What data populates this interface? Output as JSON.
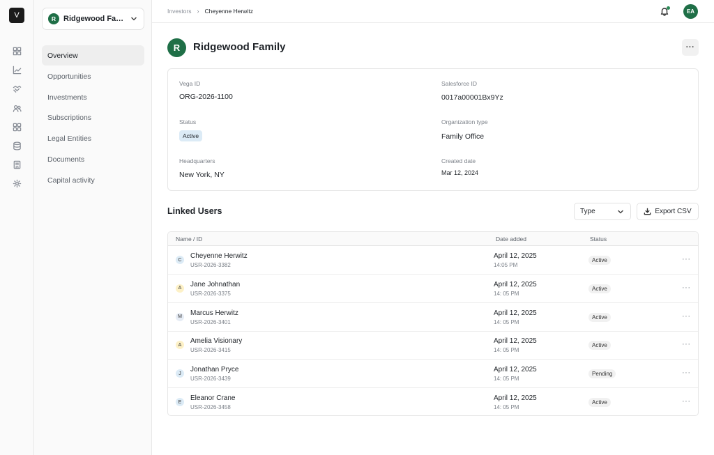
{
  "rail": {
    "logo": "V",
    "icons": [
      "dashboard-icon",
      "chart-icon",
      "handshake-icon",
      "users-icon",
      "grid-icon",
      "database-icon",
      "building-icon",
      "gear-icon"
    ]
  },
  "sidebar": {
    "org_avatar": "R",
    "org_name": "Ridgewood Family Office",
    "items": [
      {
        "label": "Overview"
      },
      {
        "label": "Opportunities"
      },
      {
        "label": "Investments"
      },
      {
        "label": "Subscriptions"
      },
      {
        "label": "Legal Entities"
      },
      {
        "label": "Documents"
      },
      {
        "label": "Capital activity"
      }
    ]
  },
  "header": {
    "breadcrumb_parent": "Investors",
    "breadcrumb_current": "Cheyenne Herwitz",
    "user_initials": "EA"
  },
  "page": {
    "avatar": "R",
    "title": "Ridgewood Family",
    "more": "···"
  },
  "details": {
    "vega_id_label": "Vega ID",
    "vega_id": "ORG-2026-1100",
    "salesforce_id_label": "Salesforce ID",
    "salesforce_id": "0017a00001Bx9Yz",
    "status_label": "Status",
    "status": "Active",
    "org_type_label": "Organization type",
    "org_type": "Family Office",
    "hq_label": "Headquarters",
    "hq": "New York, NY",
    "created_label": "Created date",
    "created": "Mar 12, 2024"
  },
  "linked_users": {
    "title": "Linked Users",
    "type_filter": "Type",
    "export_label": "Export CSV",
    "columns": [
      "Name / ID",
      "Date added",
      "Status"
    ],
    "rows": [
      {
        "initial": "C",
        "avatar_color": "#dcebf6",
        "name": "Cheyenne Herwitz",
        "id": "USR-2026-3382",
        "date": "April 12, 2025",
        "time": "14:05 PM",
        "status": "Active"
      },
      {
        "initial": "A",
        "avatar_color": "#fdf1c7",
        "name": "Jane Johnathan",
        "id": "USR-2026-3375",
        "date": "April 12, 2025",
        "time": "14: 05 PM",
        "status": "Active"
      },
      {
        "initial": "M",
        "avatar_color": "#e6ecf5",
        "name": "Marcus Herwitz",
        "id": "USR-2026-3401",
        "date": "April 12, 2025",
        "time": "14: 05 PM",
        "status": "Active"
      },
      {
        "initial": "A",
        "avatar_color": "#fdf1c7",
        "name": "Amelia Visionary",
        "id": "USR-2026-3415",
        "date": "April 12, 2025",
        "time": "14: 05 PM",
        "status": "Active"
      },
      {
        "initial": "J",
        "avatar_color": "#dcebf6",
        "name": "Jonathan Pryce",
        "id": "USR-2026-3439",
        "date": "April 12, 2025",
        "time": "14: 05 PM",
        "status": "Pending"
      },
      {
        "initial": "E",
        "avatar_color": "#dcebf6",
        "name": "Eleanor Crane",
        "id": "USR-2026-3458",
        "date": "April 12, 2025",
        "time": "14: 05 PM",
        "status": "Active"
      }
    ],
    "row_more": "···"
  }
}
